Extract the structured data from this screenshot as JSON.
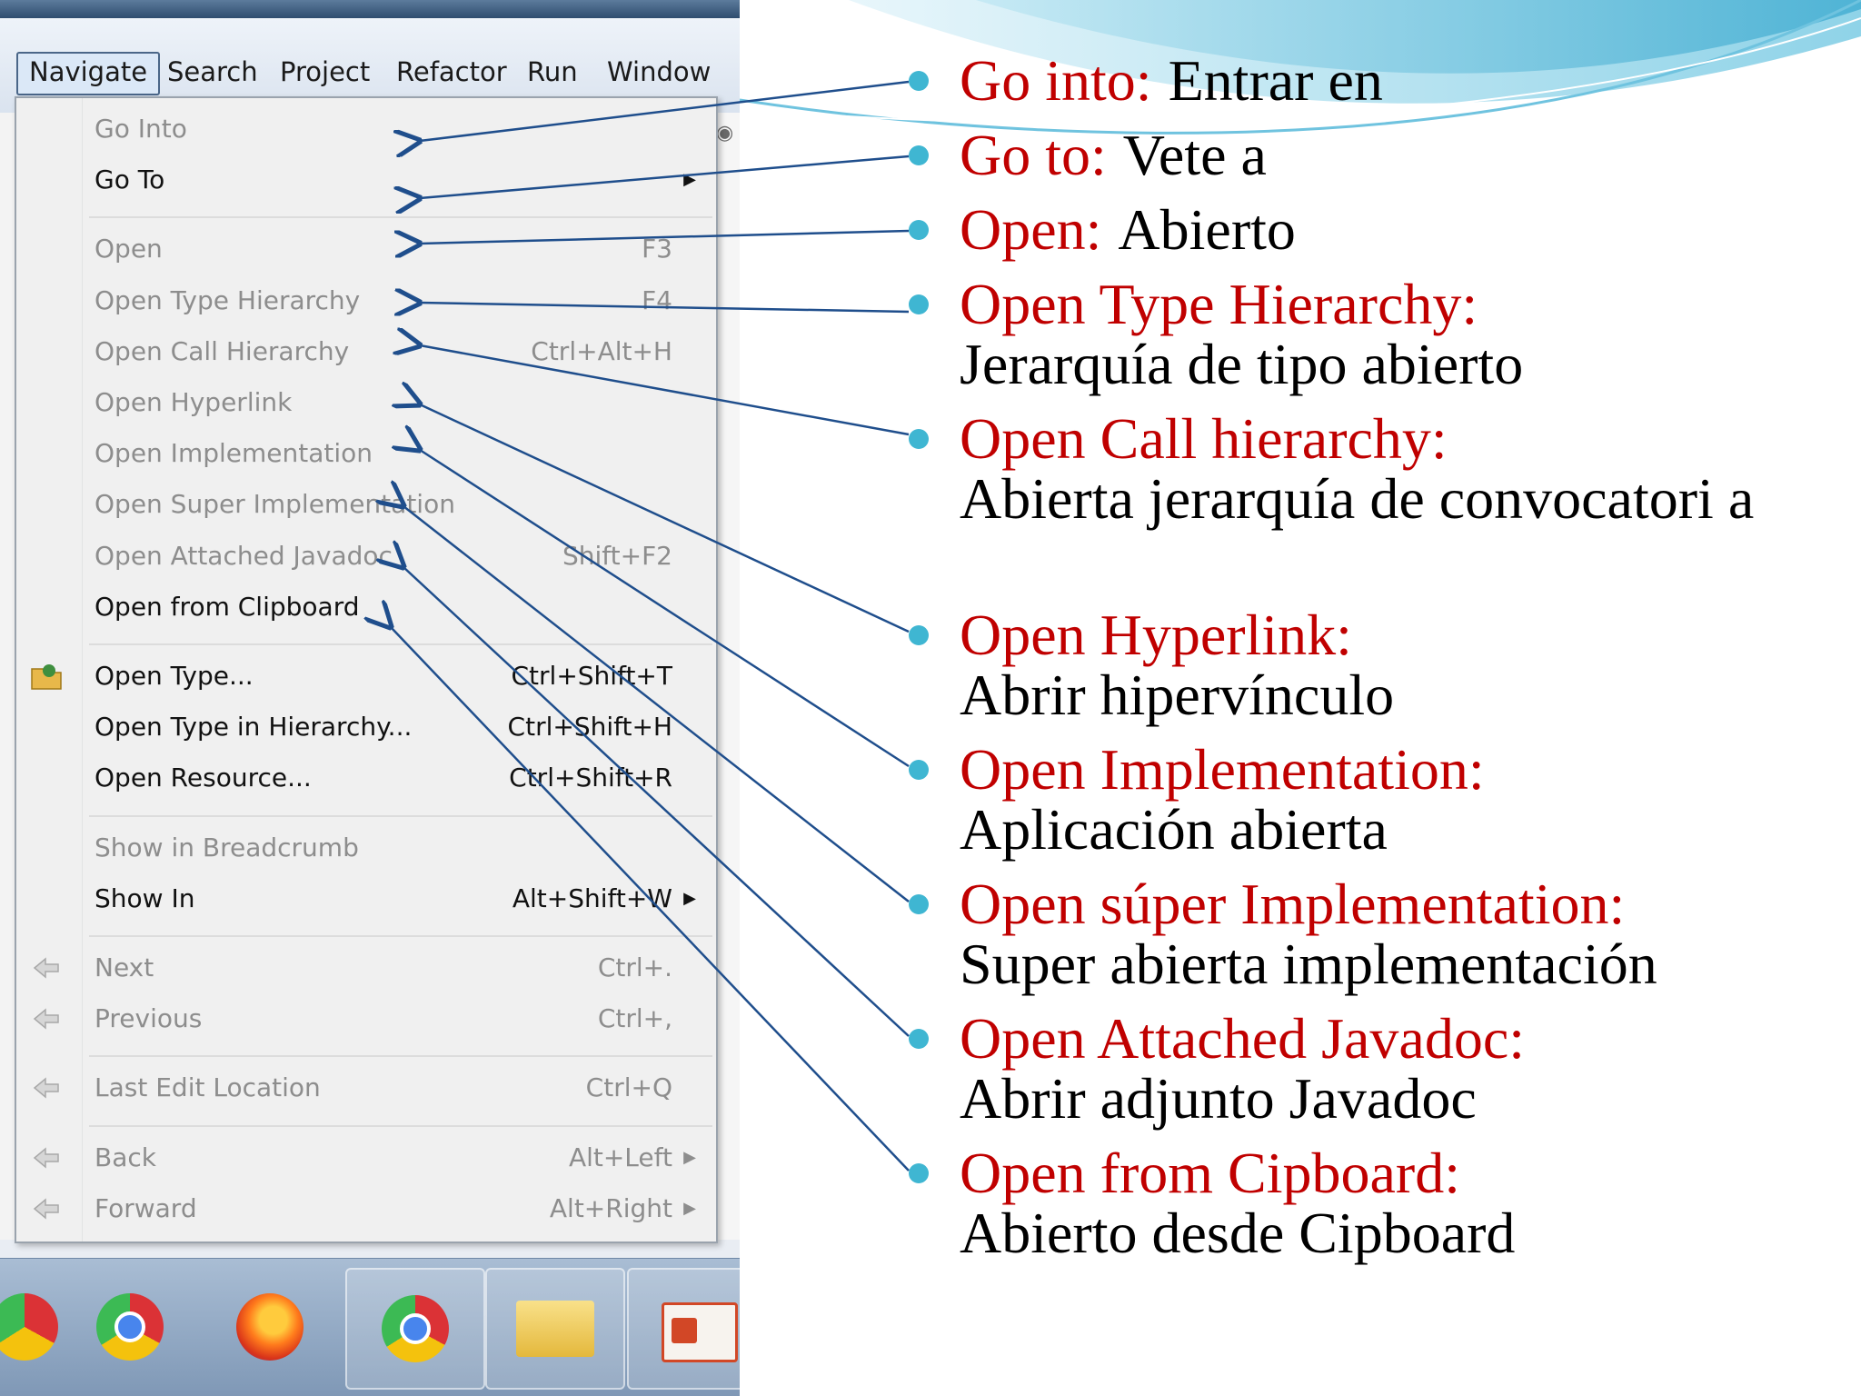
{
  "menubar": {
    "items": [
      "Navigate",
      "Search",
      "Project",
      "Refactor",
      "Run",
      "Window"
    ],
    "active": "Navigate"
  },
  "menu": {
    "items": [
      {
        "label": "Go Into",
        "shortcut": "",
        "enabled": false,
        "submenu": false,
        "icon": ""
      },
      {
        "label": "Go To",
        "shortcut": "",
        "enabled": true,
        "submenu": true,
        "icon": ""
      },
      {
        "separator": true
      },
      {
        "label": "Open",
        "shortcut": "F3",
        "enabled": false,
        "submenu": false,
        "icon": ""
      },
      {
        "label": "Open Type Hierarchy",
        "shortcut": "F4",
        "enabled": false,
        "submenu": false,
        "icon": ""
      },
      {
        "label": "Open Call Hierarchy",
        "shortcut": "Ctrl+Alt+H",
        "enabled": false,
        "submenu": false,
        "icon": ""
      },
      {
        "label": "Open Hyperlink",
        "shortcut": "",
        "enabled": false,
        "submenu": false,
        "icon": ""
      },
      {
        "label": "Open Implementation",
        "shortcut": "",
        "enabled": false,
        "submenu": false,
        "icon": ""
      },
      {
        "label": "Open Super Implementation",
        "shortcut": "",
        "enabled": false,
        "submenu": false,
        "icon": ""
      },
      {
        "label": "Open Attached Javadoc",
        "shortcut": "Shift+F2",
        "enabled": false,
        "submenu": false,
        "icon": ""
      },
      {
        "label": "Open from Clipboard",
        "shortcut": "",
        "enabled": true,
        "submenu": false,
        "icon": ""
      },
      {
        "separator": true
      },
      {
        "label": "Open Type...",
        "shortcut": "Ctrl+Shift+T",
        "enabled": true,
        "submenu": false,
        "icon": "open-type-icon"
      },
      {
        "label": "Open Type in Hierarchy...",
        "shortcut": "Ctrl+Shift+H",
        "enabled": true,
        "submenu": false,
        "icon": ""
      },
      {
        "label": "Open Resource...",
        "shortcut": "Ctrl+Shift+R",
        "enabled": true,
        "submenu": false,
        "icon": ""
      },
      {
        "separator": true
      },
      {
        "label": "Show in Breadcrumb",
        "shortcut": "",
        "enabled": false,
        "submenu": false,
        "icon": ""
      },
      {
        "label": "Show In",
        "shortcut": "Alt+Shift+W",
        "enabled": true,
        "submenu": true,
        "icon": ""
      },
      {
        "separator": true
      },
      {
        "label": "Next",
        "shortcut": "Ctrl+.",
        "enabled": false,
        "submenu": false,
        "icon": "next-annotation-icon"
      },
      {
        "label": "Previous",
        "shortcut": "Ctrl+,",
        "enabled": false,
        "submenu": false,
        "icon": "previous-annotation-icon"
      },
      {
        "separator": true
      },
      {
        "label": "Last Edit Location",
        "shortcut": "Ctrl+Q",
        "enabled": false,
        "submenu": false,
        "icon": "last-edit-icon"
      },
      {
        "separator": true
      },
      {
        "label": "Back",
        "shortcut": "Alt+Left",
        "enabled": false,
        "submenu": true,
        "icon": "back-icon"
      },
      {
        "label": "Forward",
        "shortcut": "Alt+Right",
        "enabled": false,
        "submenu": true,
        "icon": "forward-icon"
      }
    ]
  },
  "taskbar": {
    "apps": [
      "chrome-icon",
      "firefox-icon",
      "chrome-canary-icon",
      "file-explorer-icon",
      "powerpoint-icon"
    ]
  },
  "bullets": [
    {
      "term": "Go into:",
      "translation": "Entrar en",
      "inline": true
    },
    {
      "term": "Go to:",
      "translation": "Vete a",
      "inline": true
    },
    {
      "term": "Open:",
      "translation": "Abierto",
      "inline": true
    },
    {
      "term": "Open Type Hierarchy:",
      "translation": "Jerarquía de tipo abierto",
      "inline": false
    },
    {
      "term": "Open Call hierarchy:",
      "translation": "Abierta jerarquía de convocatori a",
      "inline": false
    },
    {
      "term": "Open Hyperlink:",
      "translation": "Abrir hipervínculo",
      "inline": false
    },
    {
      "term": "Open Implementation:",
      "translation": "Aplicación abierta",
      "inline": false
    },
    {
      "term": "Open súper Implementation:",
      "translation": "Super abierta implementación",
      "inline": false
    },
    {
      "term": "Open Attached Javadoc:",
      "translation": "Abrir adjunto Javadoc",
      "inline": false
    },
    {
      "term": "Open from Cipboard:",
      "translation": "Abierto desde Cipboard",
      "inline": false
    }
  ],
  "colors": {
    "term": "#c00000",
    "translation": "#000000",
    "bullet": "#3fb6d2",
    "arrow": "#1f4e8c"
  }
}
